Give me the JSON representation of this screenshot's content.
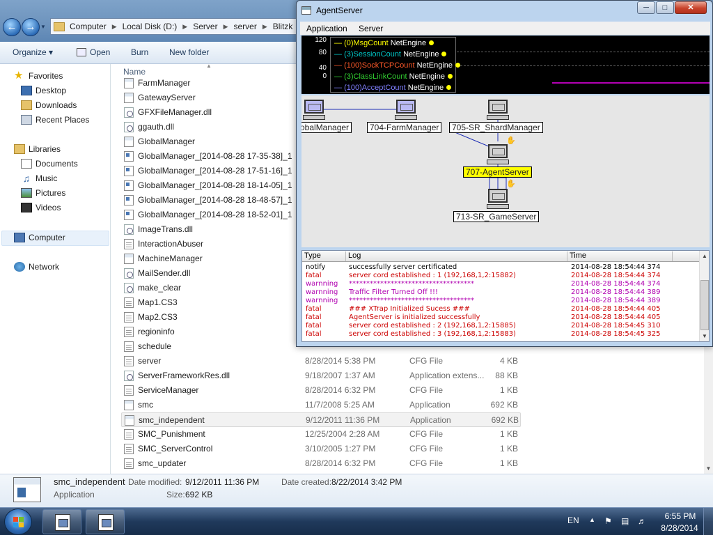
{
  "explorer": {
    "breadcrumb": [
      "Computer",
      "Local Disk (D:)",
      "Server",
      "server",
      "Blitzk"
    ],
    "toolbar": {
      "organize": "Organize ▾",
      "open": "Open",
      "burn": "Burn",
      "new_folder": "New folder"
    },
    "nav": {
      "favorites": "Favorites",
      "desktop": "Desktop",
      "downloads": "Downloads",
      "recent_places": "Recent Places",
      "libraries": "Libraries",
      "documents": "Documents",
      "music": "Music",
      "pictures": "Pictures",
      "videos": "Videos",
      "computer": "Computer",
      "network": "Network"
    },
    "column_name": "Name",
    "files": [
      {
        "name": "FarmManager",
        "icon": "app-icon",
        "date": "",
        "type": "",
        "size": ""
      },
      {
        "name": "GatewayServer",
        "icon": "app-icon",
        "date": "",
        "type": "",
        "size": ""
      },
      {
        "name": "GFXFileManager.dll",
        "icon": "dll-icon",
        "date": "",
        "type": "",
        "size": ""
      },
      {
        "name": "ggauth.dll",
        "icon": "dll-icon",
        "date": "",
        "type": "",
        "size": ""
      },
      {
        "name": "GlobalManager",
        "icon": "app-icon",
        "date": "",
        "type": "",
        "size": ""
      },
      {
        "name": "GlobalManager_[2014-08-28 17-35-38]_1",
        "icon": "log-icon",
        "date": "",
        "type": "",
        "size": ""
      },
      {
        "name": "GlobalManager_[2014-08-28 17-51-16]_1",
        "icon": "log-icon",
        "date": "",
        "type": "",
        "size": ""
      },
      {
        "name": "GlobalManager_[2014-08-28 18-14-05]_1",
        "icon": "log-icon",
        "date": "",
        "type": "",
        "size": ""
      },
      {
        "name": "GlobalManager_[2014-08-28 18-48-57]_1",
        "icon": "log-icon",
        "date": "",
        "type": "",
        "size": ""
      },
      {
        "name": "GlobalManager_[2014-08-28 18-52-01]_1",
        "icon": "log-icon",
        "date": "",
        "type": "",
        "size": ""
      },
      {
        "name": "ImageTrans.dll",
        "icon": "dll-icon",
        "date": "",
        "type": "",
        "size": ""
      },
      {
        "name": "InteractionAbuser",
        "icon": "cfg-icon",
        "date": "",
        "type": "",
        "size": ""
      },
      {
        "name": "MachineManager",
        "icon": "app-icon",
        "date": "",
        "type": "",
        "size": ""
      },
      {
        "name": "MailSender.dll",
        "icon": "dll-icon",
        "date": "",
        "type": "",
        "size": ""
      },
      {
        "name": "make_clear",
        "icon": "dll-icon",
        "date": "",
        "type": "",
        "size": ""
      },
      {
        "name": "Map1.CS3",
        "icon": "cfg-icon",
        "date": "",
        "type": "",
        "size": ""
      },
      {
        "name": "Map2.CS3",
        "icon": "cfg-icon",
        "date": "",
        "type": "",
        "size": ""
      },
      {
        "name": "regioninfo",
        "icon": "cfg-icon",
        "date": "",
        "type": "",
        "size": ""
      },
      {
        "name": "schedule",
        "icon": "cfg-icon",
        "date": "",
        "type": "",
        "size": ""
      },
      {
        "name": "server",
        "icon": "cfg-icon",
        "date": "8/28/2014 5:38 PM",
        "type": "CFG File",
        "size": "4 KB"
      },
      {
        "name": "ServerFrameworkRes.dll",
        "icon": "dll-icon",
        "date": "9/18/2007 1:37 AM",
        "type": "Application extens...",
        "size": "88 KB"
      },
      {
        "name": "ServiceManager",
        "icon": "cfg-icon",
        "date": "8/28/2014 6:32 PM",
        "type": "CFG File",
        "size": "1 KB"
      },
      {
        "name": "smc",
        "icon": "app-icon",
        "date": "11/7/2008 5:25 AM",
        "type": "Application",
        "size": "692 KB"
      },
      {
        "name": "smc_independent",
        "icon": "app-icon",
        "date": "9/12/2011 11:36 PM",
        "type": "Application",
        "size": "692 KB",
        "selected": true
      },
      {
        "name": "SMC_Punishment",
        "icon": "cfg-icon",
        "date": "12/25/2004 2:28 AM",
        "type": "CFG File",
        "size": "1 KB"
      },
      {
        "name": "SMC_ServerControl",
        "icon": "cfg-icon",
        "date": "3/10/2005 1:27 PM",
        "type": "CFG File",
        "size": "1 KB"
      },
      {
        "name": "smc_updater",
        "icon": "cfg-icon",
        "date": "8/28/2014 6:32 PM",
        "type": "CFG File",
        "size": "1 KB"
      }
    ],
    "details": {
      "name": "smc_independent",
      "type": "Application",
      "modified_label": "Date modified:",
      "modified": "9/12/2011 11:36 PM",
      "created_label": "Date created:",
      "created": "8/22/2014 3:42 PM",
      "size_label": "Size:",
      "size": "692 KB"
    }
  },
  "agent": {
    "title": "AgentServer",
    "menu": [
      "Application",
      "Server"
    ],
    "graph_ticks": [
      "120",
      "80",
      "40",
      "0"
    ],
    "legend": [
      {
        "label": "(0)MsgCount",
        "engine": "NetEngine",
        "color": "#ffff00"
      },
      {
        "label": "(3)SessionCount",
        "engine": "NetEngine",
        "color": "#00c8c8"
      },
      {
        "label": "(100)SockTCPCount",
        "engine": "NetEngine",
        "color": "#ff5a2a"
      },
      {
        "label": "(3)ClassLinkCount",
        "engine": "NetEngine",
        "color": "#32d232"
      },
      {
        "label": "(100)AcceptCount",
        "engine": "NetEngine",
        "color": "#8080ff"
      }
    ],
    "nodes": {
      "global": "obalManager",
      "farm": "704-FarmManager",
      "shard": "705-SR_ShardManager",
      "agent": "707-AgentServer",
      "game": "713-SR_GameServer"
    },
    "log_headers": {
      "type": "Type",
      "log": "Log",
      "time": "Time"
    },
    "log": [
      {
        "type": "notify",
        "msg": "successfully server certificated",
        "time": "2014-08-28 18:54:44 374",
        "color": "#000000"
      },
      {
        "type": "fatal",
        "msg": "server cord established : 1 (192,168,1,2:15882)",
        "time": "2014-08-28 18:54:44 374",
        "color": "#cc0000"
      },
      {
        "type": "warnning",
        "msg": "************************************",
        "time": "2014-08-28 18:54:44 374",
        "color": "#b000b0"
      },
      {
        "type": "warnning",
        "msg": "Traffic Filter Turned Off !!!",
        "time": "2014-08-28 18:54:44 389",
        "color": "#b000b0"
      },
      {
        "type": "warnning",
        "msg": "************************************",
        "time": "2014-08-28 18:54:44 389",
        "color": "#b000b0"
      },
      {
        "type": "fatal",
        "msg": "###   XTrap Initialized Sucess   ###",
        "time": "2014-08-28 18:54:44 405",
        "color": "#cc0000"
      },
      {
        "type": "fatal",
        "msg": "AgentServer is initialized successfully",
        "time": "2014-08-28 18:54:44 405",
        "color": "#cc0000"
      },
      {
        "type": "fatal",
        "msg": "server cord established : 2 (192,168,1,2:15885)",
        "time": "2014-08-28 18:54:45 310",
        "color": "#cc0000"
      },
      {
        "type": "fatal",
        "msg": "server cord established : 3 (192,168,1,2:15883)",
        "time": "2014-08-28 18:54:45 325",
        "color": "#cc0000"
      }
    ]
  },
  "taskbar": {
    "language": "EN",
    "time": "6:55 PM",
    "date": "8/28/2014"
  }
}
